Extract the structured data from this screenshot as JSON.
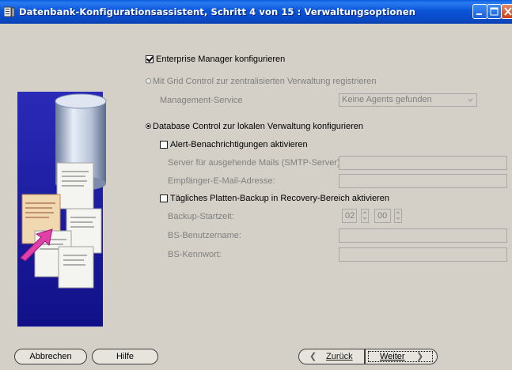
{
  "window": {
    "title": "Datenbank-Konfigurationsassistent, Schritt 4 von 15 : Verwaltungsoptionen"
  },
  "options": {
    "em_configure": {
      "label": "Enterprise Manager konfigurieren",
      "checked": true
    },
    "grid_control": {
      "label": "Mit Grid Control zur zentralisierten Verwaltung registrieren",
      "selected": false,
      "enabled": false,
      "management_service_label": "Management-Service",
      "management_service_value": "Keine Agents gefunden"
    },
    "db_control": {
      "label": "Database Control zur lokalen Verwaltung konfigurieren",
      "selected": true,
      "alerts": {
        "label": "Alert-Benachrichtigungen aktivieren",
        "checked": false,
        "smtp_label": "Server für ausgehende Mails (SMTP-Server):",
        "smtp_value": "",
        "email_label": "Empfänger-E-Mail-Adresse:",
        "email_value": ""
      },
      "backup": {
        "label": "Tägliches Platten-Backup in Recovery-Bereich aktivieren",
        "checked": false,
        "start_label": "Backup-Startzeit:",
        "start_hour": "02",
        "start_minute": "00",
        "os_user_label": "BS-Benutzername:",
        "os_user_value": "",
        "os_password_label": "BS-Kennwort:",
        "os_password_value": ""
      }
    }
  },
  "footer": {
    "cancel": "Abbrechen",
    "help": "Hilfe",
    "back": "Zurück",
    "next": "Weiter"
  }
}
